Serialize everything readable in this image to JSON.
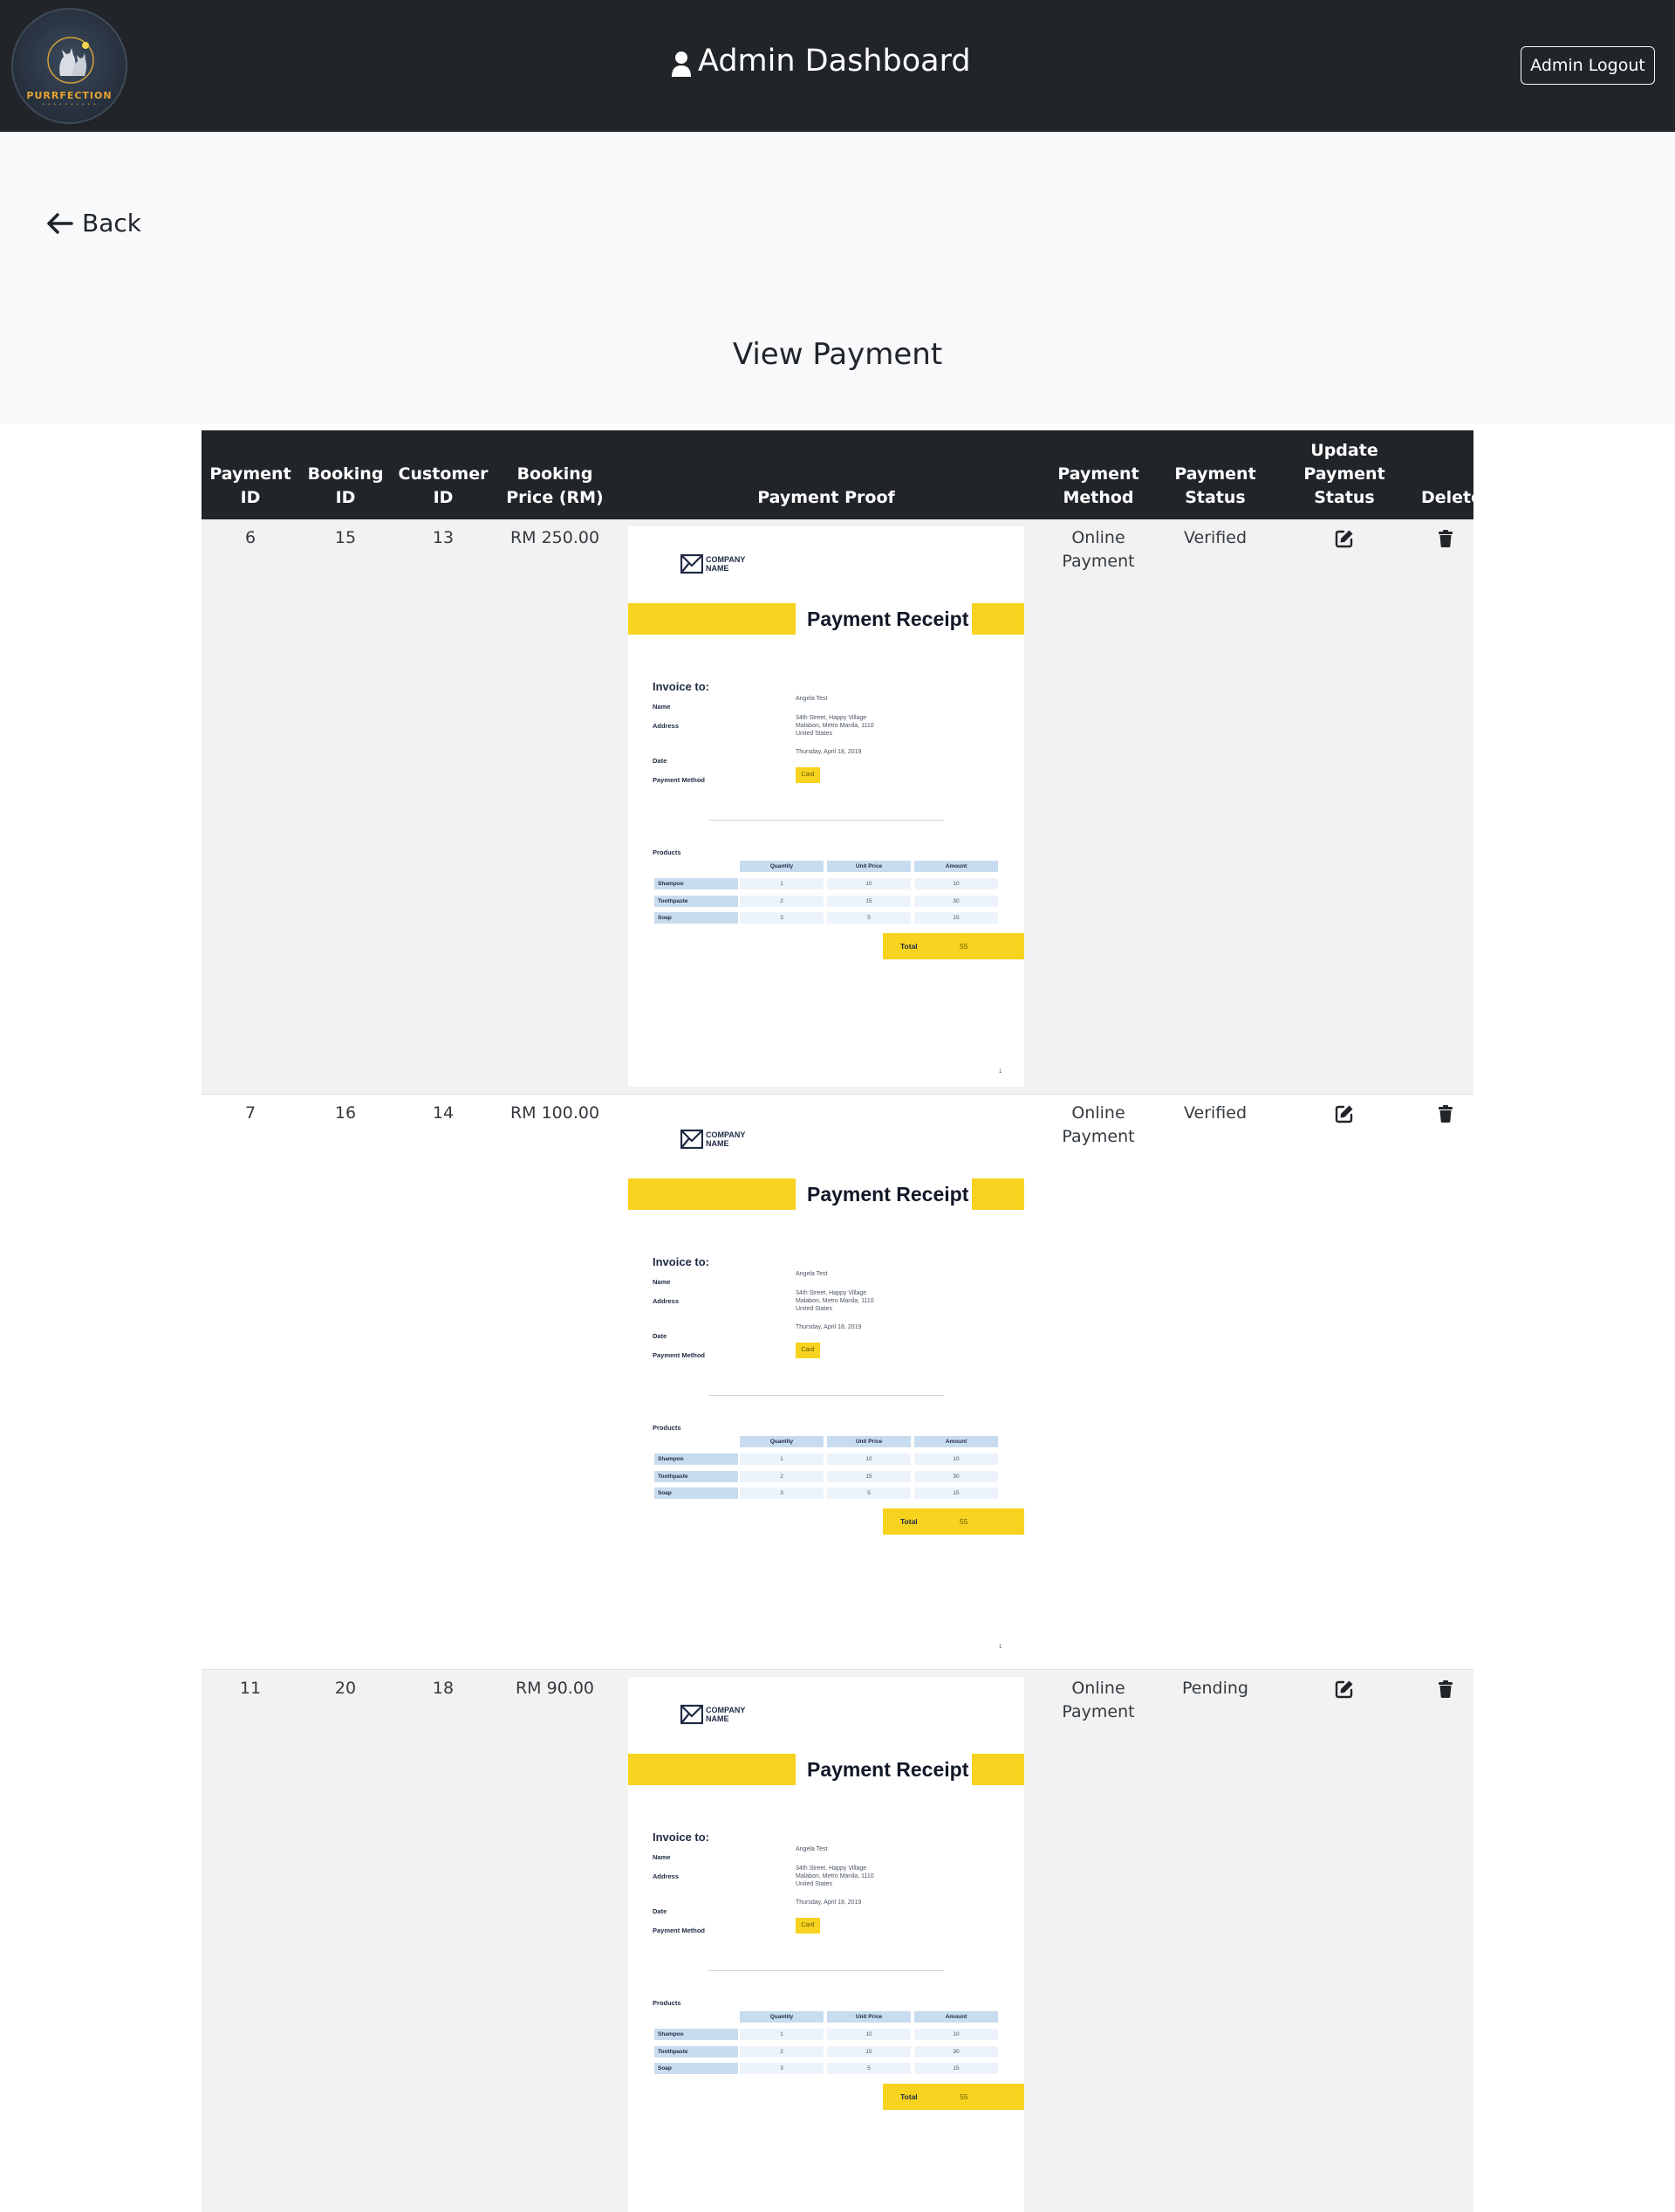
{
  "header": {
    "logo_text": "PURRFECTION",
    "title": "Admin Dashboard",
    "logout_label": "Admin Logout",
    "user_icon": "user-icon"
  },
  "nav": {
    "back_label": "Back",
    "back_icon": "arrow-left-icon"
  },
  "page": {
    "title": "View Payment"
  },
  "table": {
    "headers": {
      "payment_id": "Payment ID",
      "booking_id": "Booking ID",
      "customer_id": "Customer ID",
      "booking_price": "Booking Price (RM)",
      "payment_proof": "Payment Proof",
      "payment_method": "Payment Method",
      "payment_status": "Payment Status",
      "update_status": "Update Payment Status",
      "delete": "Delete"
    },
    "rows": [
      {
        "payment_id": "6",
        "booking_id": "15",
        "customer_id": "13",
        "booking_price": "RM 250.00",
        "payment_method": "Online Payment",
        "payment_status": "Verified"
      },
      {
        "payment_id": "7",
        "booking_id": "16",
        "customer_id": "14",
        "booking_price": "RM 100.00",
        "payment_method": "Online Payment",
        "payment_status": "Verified"
      },
      {
        "payment_id": "11",
        "booking_id": "20",
        "customer_id": "18",
        "booking_price": "RM 90.00",
        "payment_method": "Online Payment",
        "payment_status": "Pending"
      }
    ]
  },
  "receipt": {
    "company_line1": "COMPANY",
    "company_line2": "NAME",
    "title": "Payment Receipt",
    "invoice_to": "Invoice to:",
    "name_label": "Name",
    "name_value": "Angela Test",
    "address_label": "Address",
    "address_line1": "34th Street, Happy Village",
    "address_line2": "Malabon, Metro Manila, 1110",
    "address_line3": "United States",
    "date_label": "Date",
    "date_value": "Thursday, April 18, 2019",
    "payment_method_label": "Payment Method",
    "payment_method_value": "Card",
    "products_label": "Products",
    "columns": [
      "Quantity",
      "Unit Price",
      "Amount"
    ],
    "items": [
      {
        "name": "Shampoo",
        "quantity": "1",
        "unit_price": "10",
        "amount": "10"
      },
      {
        "name": "Toothpaste",
        "quantity": "2",
        "unit_price": "15",
        "amount": "30"
      },
      {
        "name": "Soap",
        "quantity": "3",
        "unit_price": "5",
        "amount": "15"
      }
    ],
    "total_label": "Total",
    "total_value": "55",
    "page_number": "1"
  },
  "colors": {
    "header_bg": "#212529",
    "accent_yellow": "#f7d31f",
    "stripe": "#f2f2f2"
  }
}
